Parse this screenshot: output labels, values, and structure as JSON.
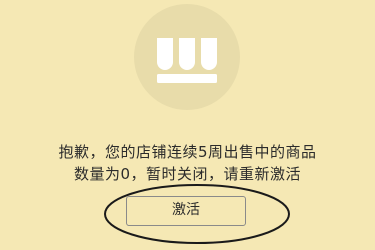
{
  "colors": {
    "background": "#f5e8b4",
    "icon_circle": "#e8dcaa",
    "icon_glyph": "#ffffff",
    "text": "#2b2b2b",
    "button_border": "#8a8a8a",
    "annotation": "#1a1a1a"
  },
  "icon": {
    "name": "store-closed-icon"
  },
  "message": {
    "line1": "抱歉，您的店铺连续5周出售中的商品",
    "line2": "数量为0，暂时关闭，请重新激活"
  },
  "activate_button": {
    "label": "激活"
  }
}
